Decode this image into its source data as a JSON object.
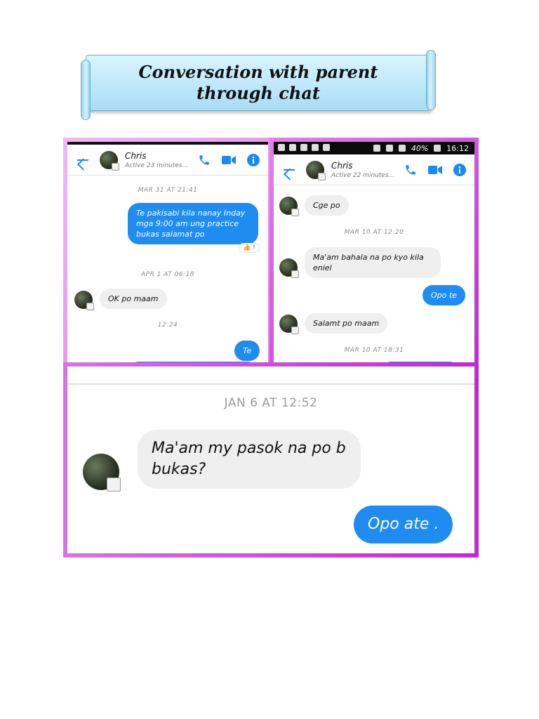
{
  "banner": {
    "title": "Conversation with parent through chat"
  },
  "screenshot_a": {
    "contact_name": "Chris",
    "contact_status": "Active 23 minutes...",
    "timestamps": [
      "MAR 31 AT 21:41",
      "APR 1 AT 06:18",
      "12:24"
    ],
    "messages": [
      {
        "dir": "out",
        "text": "Te pakisabi kila nanay Inday mga 9:00 am ung practice bukas salamat po"
      },
      {
        "dir": "in",
        "text": "OK po maam"
      },
      {
        "dir": "out",
        "text": "Te"
      }
    ],
    "reaction": "👍 !"
  },
  "screenshot_b": {
    "status_bar": {
      "battery": "40%",
      "time": "16:12"
    },
    "contact_name": "Chris",
    "contact_status": "Active 22 minutes...",
    "timestamps": [
      "MAR 10 AT 12:20",
      "MAR 10 AT 18:31"
    ],
    "messages": [
      {
        "dir": "in",
        "text": "Cge po"
      },
      {
        "dir": "in",
        "text": "Ma'am bahala na po kyo kila eniel"
      },
      {
        "dir": "out",
        "text": "Opo te"
      },
      {
        "dir": "in",
        "text": "Salamt po maam"
      }
    ]
  },
  "screenshot_c": {
    "timestamp": "JAN 6 AT 12:52",
    "messages": [
      {
        "dir": "in",
        "text": "Ma'am my pasok na po b bukas?"
      },
      {
        "dir": "out",
        "text": "Opo ate ."
      }
    ]
  },
  "colors": {
    "accent": "#1f8cf2",
    "frame_border": "#d36be6",
    "banner_bg": "#c2e9fb"
  }
}
